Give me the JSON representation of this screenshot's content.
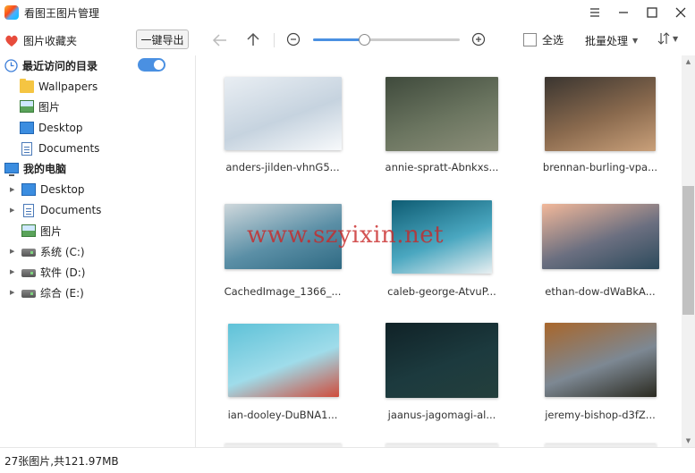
{
  "window": {
    "title": "看图王图片管理",
    "controls": [
      "menu-icon",
      "minimize-icon",
      "maximize-icon",
      "close-icon"
    ]
  },
  "toolbar": {
    "favorites_label": "图片收藏夹",
    "export_label": "一键导出",
    "select_all_label": "全选",
    "batch_label": "批量处理",
    "zoom_level": 0.35
  },
  "sidebar": {
    "recent_label": "最近访问的目录",
    "recent_toggle_on": true,
    "recent_items": [
      {
        "label": "Wallpapers",
        "icon": "folder-icon"
      },
      {
        "label": "图片",
        "icon": "image-folder-icon"
      },
      {
        "label": "Desktop",
        "icon": "desktop-icon"
      },
      {
        "label": "Documents",
        "icon": "documents-icon"
      }
    ],
    "computer_label": "我的电脑",
    "computer_items": [
      {
        "label": "Desktop",
        "icon": "desktop-icon"
      },
      {
        "label": "Documents",
        "icon": "documents-icon"
      },
      {
        "label": "图片",
        "icon": "image-folder-icon"
      },
      {
        "label": "系统 (C:)",
        "icon": "drive-icon"
      },
      {
        "label": "软件 (D:)",
        "icon": "drive-icon"
      },
      {
        "label": "综合 (E:)",
        "icon": "drive-icon"
      }
    ]
  },
  "gallery": {
    "images": [
      {
        "name": "anders-jilden-vhnG5...",
        "colors": [
          "#e9eef3",
          "#c6d3df",
          "#f7f9fb"
        ]
      },
      {
        "name": "annie-spratt-Abnkxs...",
        "colors": [
          "#3f4a3c",
          "#6b7560",
          "#8c8f7a"
        ]
      },
      {
        "name": "brennan-burling-vpa...",
        "colors": [
          "#3a3530",
          "#8a6a4e",
          "#c9a07a"
        ]
      },
      {
        "name": "CachedImage_1366_...",
        "colors": [
          "#cfd8dc",
          "#5b8fa6",
          "#2f6a83"
        ]
      },
      {
        "name": "caleb-george-AtvuP...",
        "colors": [
          "#0e5c73",
          "#4aa7c0",
          "#e9eff1"
        ]
      },
      {
        "name": "ethan-dow-dWaBkA...",
        "colors": [
          "#f2b89a",
          "#6b6f80",
          "#2c4a5c"
        ]
      },
      {
        "name": "ian-dooley-DuBNA1...",
        "colors": [
          "#5fc2d8",
          "#9fdcea",
          "#cf4c3c"
        ]
      },
      {
        "name": "jaanus-jagomagi-al...",
        "colors": [
          "#102227",
          "#1c3a3e",
          "#243f3c"
        ]
      },
      {
        "name": "jeremy-bishop-d3fZ...",
        "colors": [
          "#a8662b",
          "#7d8893",
          "#2b2a20"
        ]
      }
    ]
  },
  "watermark": "www.szyixin.net",
  "status": {
    "summary": "27张图片,共121.97MB"
  }
}
